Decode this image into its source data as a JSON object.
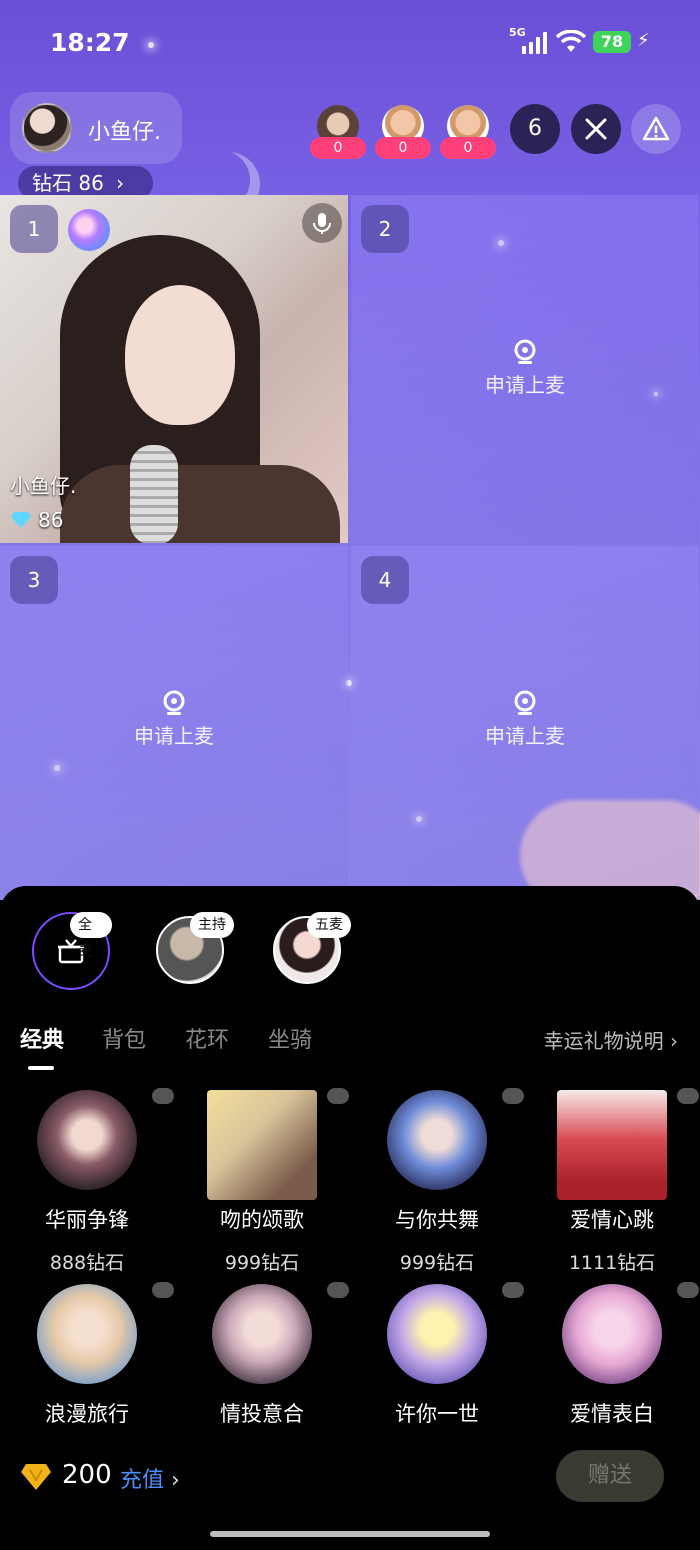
{
  "status": {
    "time": "18:27",
    "network": "5G",
    "battery": "78"
  },
  "header": {
    "host_name": "小鱼仔.",
    "diamond_label": "钻石",
    "diamond_value": "86",
    "viewer_counts": [
      "0",
      "0",
      "0"
    ],
    "online_count": "6"
  },
  "seats": [
    {
      "num": "1",
      "name": "小鱼仔.",
      "diamonds": "86"
    },
    {
      "num": "2",
      "action": "申请上麦"
    },
    {
      "num": "3",
      "action": "申请上麦"
    },
    {
      "num": "4",
      "action": "申请上麦"
    }
  ],
  "targets": [
    {
      "tag": "全麦"
    },
    {
      "tag": "主持"
    },
    {
      "tag": "五麦"
    }
  ],
  "tabs": [
    "经典",
    "背包",
    "花环",
    "坐骑"
  ],
  "luck_link": "幸运礼物说明",
  "gifts": [
    {
      "name": "华丽争锋",
      "price": "888钻石",
      "color": "#b89aa0"
    },
    {
      "name": "吻的颂歌",
      "price": "999钻石",
      "color": "#d8c49a"
    },
    {
      "name": "与你共舞",
      "price": "999钻石",
      "color": "#8fa0d8"
    },
    {
      "name": "爱情心跳",
      "price": "1111钻石",
      "color": "#d84a52"
    },
    {
      "name": "浪漫旅行",
      "price": "",
      "color": "#e6c9a8"
    },
    {
      "name": "情投意合",
      "price": "",
      "color": "#caa8b8"
    },
    {
      "name": "许你一世",
      "price": "",
      "color": "#c2a8e8"
    },
    {
      "name": "爱情表白",
      "price": "",
      "color": "#e6a8d2"
    }
  ],
  "footer": {
    "balance": "200",
    "recharge": "充值",
    "send": "赠送"
  }
}
